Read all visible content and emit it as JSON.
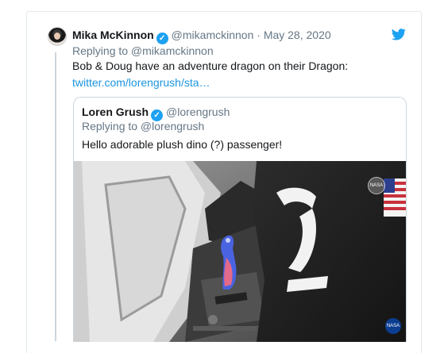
{
  "tweet": {
    "author_name": "Mika McKinnon",
    "verified_glyph": "✓",
    "handle": "@mikamckinnon",
    "separator": "·",
    "date": "May 28, 2020",
    "replying_to": "Replying to @mikamckinnon",
    "text": "Bob & Doug have an adventure dragon on their Dragon:",
    "link": "twitter.com/lorengrush/sta…",
    "avatar_icon": "user-avatar",
    "brand_icon": "twitter-bird-icon"
  },
  "quoted_tweet": {
    "author_name": "Loren Grush",
    "verified_glyph": "✓",
    "handle": "@lorengrush",
    "replying_to": "Replying to @lorengrush",
    "text": "Hello adorable plush dino (?) passenger!",
    "media": {
      "badge_top_text": "NASA",
      "badge_bottom_text": "NASA"
    }
  },
  "colors": {
    "verified_blue": "#1da1f2",
    "link_blue": "#1b95e0",
    "muted_gray": "#657786",
    "border": "#e1e8ed",
    "dino_blue": "#4a63e0",
    "dino_pink": "#e36a8a"
  }
}
